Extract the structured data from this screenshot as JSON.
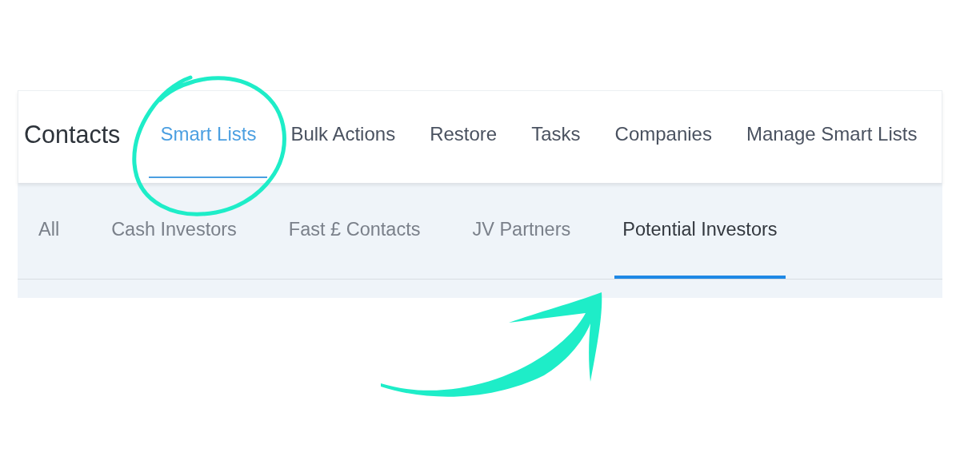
{
  "header": {
    "title": "Contacts"
  },
  "tabs": [
    {
      "label": "Smart Lists",
      "selected": true
    },
    {
      "label": "Bulk Actions",
      "selected": false
    },
    {
      "label": "Restore",
      "selected": false
    },
    {
      "label": "Tasks",
      "selected": false
    },
    {
      "label": "Companies",
      "selected": false
    },
    {
      "label": "Manage Smart Lists",
      "selected": false
    }
  ],
  "smart_lists": [
    {
      "label": "All",
      "selected": false
    },
    {
      "label": "Cash Investors",
      "selected": false
    },
    {
      "label": "Fast £ Contacts",
      "selected": false
    },
    {
      "label": "JV Partners",
      "selected": false
    },
    {
      "label": "Potential Investors",
      "selected": true
    }
  ]
}
